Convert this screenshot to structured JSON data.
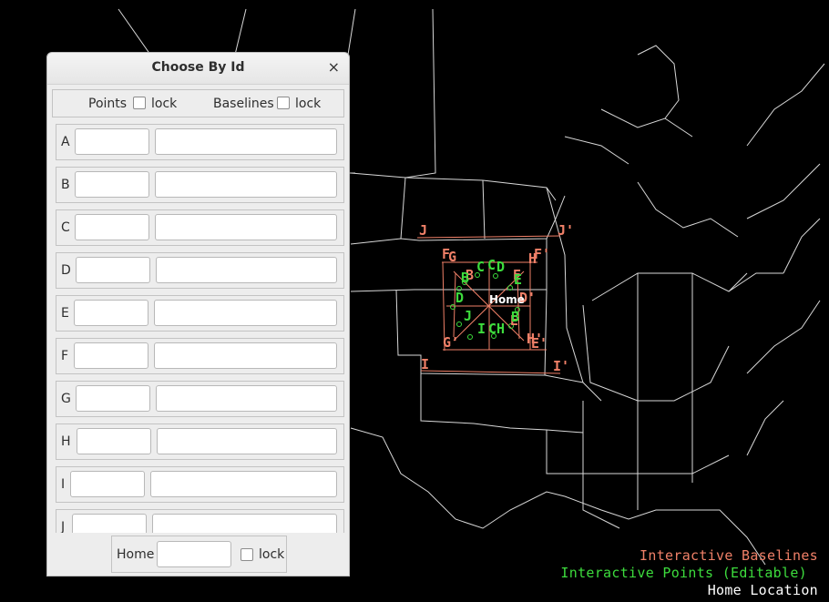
{
  "dialog": {
    "title": "Choose By Id",
    "close_glyph": "×",
    "points_label": "Points",
    "baselines_label": "Baselines",
    "lock_label": "lock",
    "points_lock_checked": false,
    "baselines_lock_checked": false,
    "rows": [
      {
        "id": "A",
        "short": "",
        "long": ""
      },
      {
        "id": "B",
        "short": "",
        "long": ""
      },
      {
        "id": "C",
        "short": "",
        "long": ""
      },
      {
        "id": "D",
        "short": "",
        "long": ""
      },
      {
        "id": "E",
        "short": "",
        "long": ""
      },
      {
        "id": "F",
        "short": "",
        "long": ""
      },
      {
        "id": "G",
        "short": "",
        "long": ""
      },
      {
        "id": "H",
        "short": "",
        "long": ""
      },
      {
        "id": "I",
        "short": "",
        "long": ""
      },
      {
        "id": "J",
        "short": "",
        "long": ""
      }
    ],
    "home_label": "Home",
    "home_value": "",
    "home_lock_label": "lock"
  },
  "map": {
    "home_marker_label": "Home",
    "baseline_labels": [
      "J",
      "J'",
      "F",
      "G",
      "F'",
      "H",
      "B",
      "E",
      "D'",
      "E",
      "H'",
      "E'",
      "I",
      "I'",
      "G'"
    ],
    "point_labels": [
      "C",
      "C",
      "D",
      "E",
      "B",
      "D",
      "J",
      "I",
      "C",
      "H",
      "B"
    ]
  },
  "legend": {
    "baselines": "Interactive Baselines",
    "points": "Interactive Points (Editable)",
    "home": "Home Location"
  },
  "colors": {
    "baseline": "#f08068",
    "point": "#3ddc3d",
    "home": "#ffffff",
    "background": "#000000",
    "map_lines": "#d8d8d8"
  }
}
